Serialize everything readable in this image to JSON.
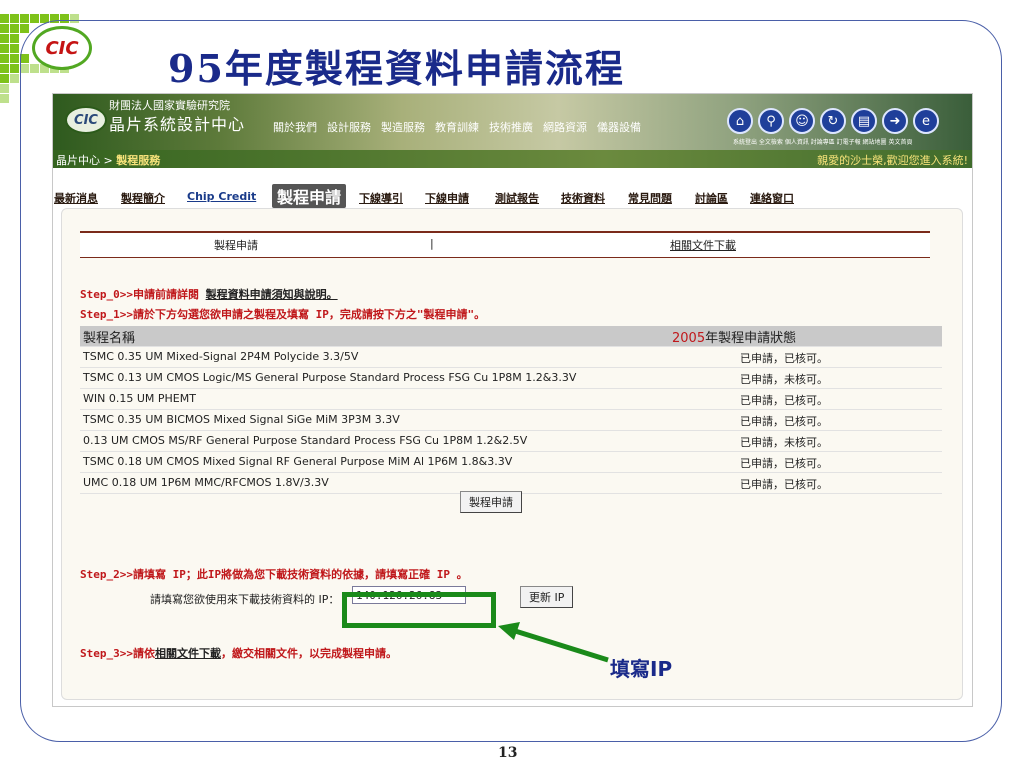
{
  "slide": {
    "title": "95年度製程資料申請流程",
    "logo_text": "CIC",
    "page_number": "13",
    "annotation_label": "填寫IP"
  },
  "banner": {
    "org_line": "財團法人國家實驗研究院",
    "center_name": "晶片系統設計中心",
    "logo_text": "CIC",
    "nav": [
      "關於我們",
      "設計服務",
      "製造服務",
      "教育訓練",
      "技術推廣",
      "網路資源",
      "儀器設備"
    ],
    "icon_names": [
      "home-icon",
      "search-icon",
      "user-icon",
      "refresh-icon",
      "document-icon",
      "arrow-icon",
      "browser-icon"
    ],
    "icon_labels": "系統登出 全文檢索 個人資訊 討論專區 訂電子報 網站地圖 英文首頁"
  },
  "breadcrumb": {
    "root": "晶片中心 > ",
    "current": "製程服務",
    "welcome": "親愛的沙士榮,歡迎您進入系統!"
  },
  "tabs": [
    "最新消息",
    "製程簡介",
    "Chip Credit",
    "製程申請",
    "下線導引",
    "下線申請",
    "測試報告",
    "技術資料",
    "常見問題",
    "討論區",
    "連絡窗口"
  ],
  "subnav": {
    "left": "製程申請",
    "divider": "|",
    "right": "相關文件下載"
  },
  "steps": {
    "step0_prefix": "Step_0>>申請前請詳閱 ",
    "step0_link": "製程資料申請須知與說明。",
    "step1": "Step_1>>請於下方勾選您欲申請之製程及填寫 IP，完成請按下方之\"製程申請\"。",
    "step2": "Step_2>>請填寫 IP；此IP將做為您下載技術資料的依據，請填寫正確 IP 。",
    "step3_prefix": "Step_3>>請依",
    "step3_link": "相關文件下載",
    "step3_suffix": "，繳交相關文件，以完成製程申請。"
  },
  "table": {
    "col_name": "製程名稱",
    "col_status_year": "2005",
    "col_status_text": "年製程申請狀態",
    "rows": [
      {
        "name": "TSMC 0.35 UM Mixed-Signal 2P4M Polycide 3.3/5V",
        "status": "已申請，已核可。"
      },
      {
        "name": "TSMC 0.13 UM CMOS Logic/MS General Purpose Standard Process FSG Cu 1P8M 1.2&3.3V",
        "status": "已申請，未核可。"
      },
      {
        "name": "WIN 0.15 UM PHEMT",
        "status": "已申請，已核可。"
      },
      {
        "name": "TSMC 0.35 UM BICMOS Mixed Signal SiGe MiM 3P3M 3.3V",
        "status": "已申請，已核可。"
      },
      {
        "name": "0.13 UM CMOS MS/RF General Purpose Standard Process FSG Cu 1P8M 1.2&2.5V",
        "status": "已申請，未核可。"
      },
      {
        "name": "TSMC 0.18 UM CMOS Mixed Signal RF General Purpose MiM Al 1P6M 1.8&3.3V",
        "status": "已申請，已核可。"
      },
      {
        "name": "UMC 0.18 UM 1P6M MMC/RFCMOS 1.8V/3.3V",
        "status": "已申請，已核可。"
      }
    ],
    "apply_button": "製程申請"
  },
  "ip": {
    "label": "請填寫您欲使用來下載技術資料的 IP：",
    "value": "140.126.26.83",
    "update_button": "更新 IP"
  },
  "colors": {
    "title": "#1a2a8a",
    "step_red": "#c0181b",
    "highlight_green": "#1a8a1a",
    "banner_green": "#3a6b28"
  }
}
